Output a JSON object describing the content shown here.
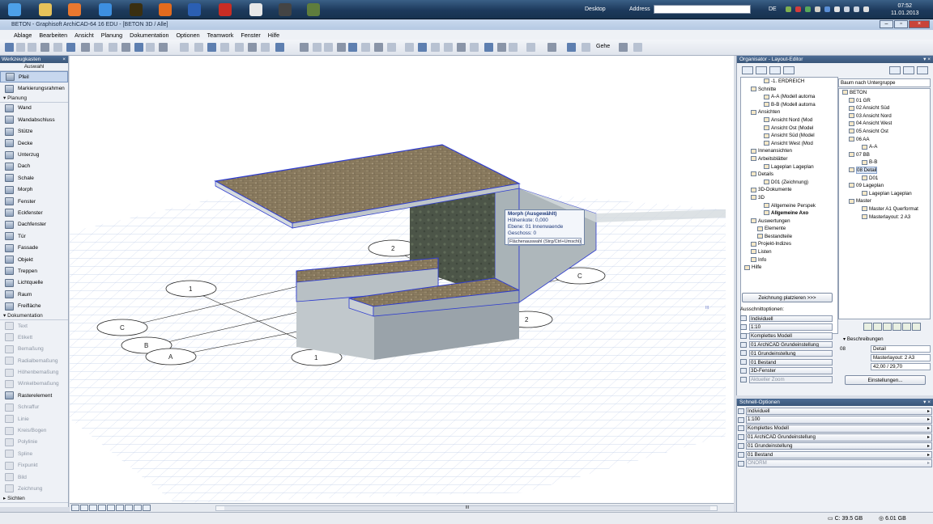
{
  "taskbar": {
    "desktop_label": "Desktop",
    "address_label": "Address",
    "language": "DE",
    "time": "07:52",
    "date": "11.01.2013",
    "app_icons": [
      "explorer-icon",
      "folder-icon",
      "media-player-icon",
      "internet-explorer-icon",
      "illustrator-icon",
      "firefox-icon",
      "word-icon",
      "acrobat-icon",
      "archicad-icon",
      "tool-icon",
      "artlantis-icon"
    ]
  },
  "window": {
    "title": "BETON - Graphisoft ArchiCAD-64 16 EDU - [BETON 3D / Alle]"
  },
  "menu": [
    "Ablage",
    "Bearbeiten",
    "Ansicht",
    "Planung",
    "Dokumentation",
    "Optionen",
    "Teamwork",
    "Fenster",
    "Hilfe"
  ],
  "toolbar": {
    "gehe_label": "Gehe"
  },
  "toolbox": {
    "title": "Werkzeugkasten",
    "auswahl": "Auswahl",
    "selection_tools": [
      {
        "label": "Pfeil",
        "icon": "arrow-icon"
      },
      {
        "label": "Markierungsrahmen",
        "icon": "marquee-icon"
      }
    ],
    "planung_header": "Planung",
    "planung_tools": [
      {
        "label": "Wand",
        "icon": "wall-icon"
      },
      {
        "label": "Wandabschluss",
        "icon": "wall-end-icon"
      },
      {
        "label": "Stütze",
        "icon": "column-icon"
      },
      {
        "label": "Decke",
        "icon": "slab-icon"
      },
      {
        "label": "Unterzug",
        "icon": "beam-icon"
      },
      {
        "label": "Dach",
        "icon": "roof-icon"
      },
      {
        "label": "Schale",
        "icon": "shell-icon"
      },
      {
        "label": "Morph",
        "icon": "morph-icon"
      },
      {
        "label": "Fenster",
        "icon": "window-icon"
      },
      {
        "label": "Eckfenster",
        "icon": "corner-window-icon"
      },
      {
        "label": "Dachfenster",
        "icon": "skylight-icon"
      },
      {
        "label": "Tür",
        "icon": "door-icon"
      },
      {
        "label": "Fassade",
        "icon": "curtain-wall-icon"
      },
      {
        "label": "Objekt",
        "icon": "object-icon"
      },
      {
        "label": "Treppen",
        "icon": "stair-icon"
      },
      {
        "label": "Lichtquelle",
        "icon": "lamp-icon"
      },
      {
        "label": "Raum",
        "icon": "zone-icon"
      },
      {
        "label": "Freifläche",
        "icon": "mesh-icon"
      }
    ],
    "dokumentation_header": "Dokumentation",
    "dokumentation_tools": [
      {
        "label": "Text",
        "icon": "text-icon",
        "enabled": false
      },
      {
        "label": "Etikett",
        "icon": "label-icon",
        "enabled": false
      },
      {
        "label": "Bemaßung",
        "icon": "dimension-icon",
        "enabled": false
      },
      {
        "label": "Radialbemaßung",
        "icon": "radial-dimension-icon",
        "enabled": false
      },
      {
        "label": "Höhenbemaßung",
        "icon": "level-dimension-icon",
        "enabled": false
      },
      {
        "label": "Winkelbemaßung",
        "icon": "angle-dimension-icon",
        "enabled": false
      },
      {
        "label": "Rasterelement",
        "icon": "grid-element-icon",
        "enabled": true
      },
      {
        "label": "Schraffur",
        "icon": "fill-icon",
        "enabled": false
      },
      {
        "label": "Linie",
        "icon": "line-icon",
        "enabled": false
      },
      {
        "label": "Kreis/Bogen",
        "icon": "circle-icon",
        "enabled": false
      },
      {
        "label": "Polylinie",
        "icon": "polyline-icon",
        "enabled": false
      },
      {
        "label": "Spline",
        "icon": "spline-icon",
        "enabled": false
      },
      {
        "label": "Fixpunkt",
        "icon": "hotspot-icon",
        "enabled": false
      },
      {
        "label": "Bild",
        "icon": "figure-icon",
        "enabled": false
      },
      {
        "label": "Zeichnung",
        "icon": "drawing-icon",
        "enabled": false
      }
    ],
    "sichten_label": "Sichten"
  },
  "viewport": {
    "grid_labels": [
      "1",
      "2",
      "C",
      "B",
      "A",
      "A",
      "B",
      "C",
      "1",
      "2"
    ],
    "infobox": {
      "title": "Morph (Ausgewählt)",
      "line1": "Höhenkote: 0,000",
      "line2": "Ebene: 01 Innenwaende",
      "line3": "Geschoss: 0",
      "footer": "Flächenauswahl (Strg/Ctrl+Umschl)"
    },
    "scroll_marker": "III"
  },
  "organizer": {
    "title": "Organisator - Layout-Editor",
    "tree_left": [
      {
        "label": "-1. ERDREICH",
        "indent": 3
      },
      {
        "label": "Schnitte",
        "indent": 1
      },
      {
        "label": "A-A (Modell automa",
        "indent": 3
      },
      {
        "label": "B-B (Modell automa",
        "indent": 3
      },
      {
        "label": "Ansichten",
        "indent": 1
      },
      {
        "label": "Ansicht Nord (Mod",
        "indent": 3
      },
      {
        "label": "Ansicht Ost (Model",
        "indent": 3
      },
      {
        "label": "Ansicht Süd (Model",
        "indent": 3
      },
      {
        "label": "Ansicht West (Mod",
        "indent": 3
      },
      {
        "label": "Innenansichten",
        "indent": 1
      },
      {
        "label": "Arbeitsblätter",
        "indent": 1
      },
      {
        "label": "Lageplan Lageplan",
        "indent": 3
      },
      {
        "label": "Details",
        "indent": 1
      },
      {
        "label": "D01 (Zeichnung)",
        "indent": 3
      },
      {
        "label": "3D-Dokumente",
        "indent": 1
      },
      {
        "label": "3D",
        "indent": 1
      },
      {
        "label": "Allgemeine Perspek",
        "indent": 3
      },
      {
        "label": "Allgemeine Axo",
        "indent": 3,
        "bold": true
      },
      {
        "label": "Auswertungen",
        "indent": 1
      },
      {
        "label": "Elemente",
        "indent": 2
      },
      {
        "label": "Bestandteile",
        "indent": 2
      },
      {
        "label": "Projekt-Indizes",
        "indent": 1
      },
      {
        "label": "Listen",
        "indent": 1
      },
      {
        "label": "Info",
        "indent": 1
      },
      {
        "label": "Hilfe",
        "indent": 0
      }
    ],
    "tree_right_combo": "Baum nach Untergruppe",
    "tree_right": [
      {
        "label": "BETON",
        "indent": 0
      },
      {
        "label": "01 GR",
        "indent": 1
      },
      {
        "label": "02 Ansicht Süd",
        "indent": 1
      },
      {
        "label": "03 Ansicht Nord",
        "indent": 1
      },
      {
        "label": "04 Ansicht West",
        "indent": 1
      },
      {
        "label": "05 Ansicht Ost",
        "indent": 1
      },
      {
        "label": "06 AA",
        "indent": 1
      },
      {
        "label": "A-A",
        "indent": 3
      },
      {
        "label": "07 BB",
        "indent": 1
      },
      {
        "label": "B-B",
        "indent": 3
      },
      {
        "label": "08 Detail",
        "indent": 1,
        "selected": true
      },
      {
        "label": "D01",
        "indent": 3
      },
      {
        "label": "09 Lageplan",
        "indent": 1
      },
      {
        "label": "Lageplan Lageplan",
        "indent": 3
      },
      {
        "label": "Master",
        "indent": 1
      },
      {
        "label": "Master A1 Querformat",
        "indent": 3
      },
      {
        "label": "Masterlayout: 2 A3",
        "indent": 3
      }
    ],
    "place_button": "Zeichnung platzieren >>>",
    "cut_options_label": "Ausschnittoptionen:",
    "cut_options": [
      {
        "value": "Individuell",
        "enabled": true
      },
      {
        "value": "1:10",
        "enabled": true
      },
      {
        "value": "Komplettes Modell",
        "enabled": true
      },
      {
        "value": "01 ArchiCAD Grundeinstellung",
        "enabled": true
      },
      {
        "value": "01 Grundeinstellung",
        "enabled": true
      },
      {
        "value": "01 Bestand",
        "enabled": true
      },
      {
        "value": "3D-Fenster",
        "enabled": true
      },
      {
        "value": "Aktueller Zoom",
        "enabled": false
      }
    ],
    "descriptions_label": "Beschreibungen",
    "props": [
      {
        "key": "08",
        "value": "Detail"
      },
      {
        "key": "",
        "value": "Masterlayout: 2 A3"
      },
      {
        "key": "",
        "value": "42,00 / 29,70"
      }
    ],
    "settings_button": "Einstellungen..."
  },
  "quick_options": {
    "title": "Schnell-Optionen",
    "rows": [
      {
        "value": "Individuell",
        "enabled": true
      },
      {
        "value": "1:100",
        "enabled": true
      },
      {
        "value": "Komplettes Modell",
        "enabled": true
      },
      {
        "value": "01 ArchiCAD Grundeinstellung",
        "enabled": true
      },
      {
        "value": "01 Grundeinstellung",
        "enabled": true
      },
      {
        "value": "01 Bestand",
        "enabled": true
      },
      {
        "value": "ÖNORM",
        "enabled": false
      }
    ]
  },
  "status": {
    "disk": "C: 39.5 GB",
    "ram": "6.01 GB"
  },
  "colors": {
    "taskbar": "#1d3a5c",
    "selection_blue": "#2e3ccf",
    "grid": "#b7c5e6",
    "concrete": "#a7b1b6",
    "brick": "#8a7a5e"
  }
}
